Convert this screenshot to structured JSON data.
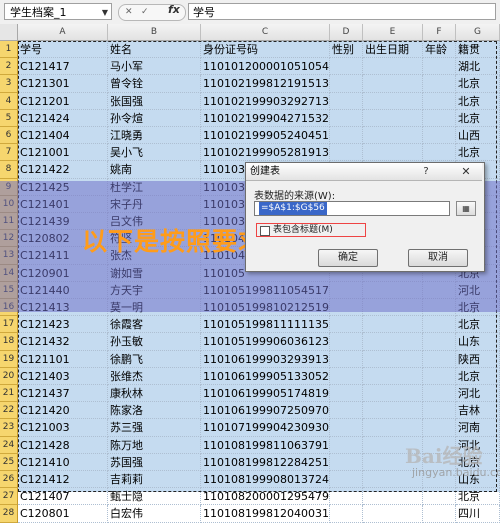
{
  "formula_bar": {
    "name_box": "学生档案_1",
    "fx": "fx",
    "content": "学号"
  },
  "columns": [
    "A",
    "B",
    "C",
    "D",
    "E",
    "F",
    "G"
  ],
  "header": [
    "学号",
    "姓名",
    "身份证号码",
    "性别",
    "出生日期",
    "年龄",
    "籍贯"
  ],
  "rows": [
    [
      "C121417",
      "马小军",
      "110101200001051054",
      "",
      "",
      "",
      "湖北"
    ],
    [
      "C121301",
      "曾令铨",
      "110102199812191513",
      "",
      "",
      "",
      "北京"
    ],
    [
      "C121201",
      "张国强",
      "110102199903292713",
      "",
      "",
      "",
      "北京"
    ],
    [
      "C121424",
      "孙令煊",
      "110102199904271532",
      "",
      "",
      "",
      "北京"
    ],
    [
      "C121404",
      "江晓勇",
      "110102199905240451",
      "",
      "",
      "",
      "山西"
    ],
    [
      "C121001",
      "吴小飞",
      "110102199905281913",
      "",
      "",
      "",
      "北京"
    ],
    [
      "C121422",
      "姚南",
      "110103",
      "",
      "",
      "",
      "北京"
    ],
    [
      "C121425",
      "杜学江",
      "110103",
      "",
      "",
      "",
      "北京"
    ],
    [
      "C121401",
      "宋子丹",
      "110103",
      "",
      "",
      "",
      "北京"
    ],
    [
      "C121439",
      "吕文伟",
      "110103",
      "",
      "",
      "",
      "湖南"
    ],
    [
      "C120802",
      "符坚",
      "110104",
      "",
      "",
      "",
      "山西"
    ],
    [
      "C121411",
      "张杰",
      "110104",
      "",
      "",
      "",
      "北京"
    ],
    [
      "C120901",
      "谢如雪",
      "110105",
      "",
      "",
      "",
      "北京"
    ],
    [
      "C121440",
      "方天宇",
      "110105199811054517",
      "",
      "",
      "",
      "河北"
    ],
    [
      "C121413",
      "莫一明",
      "110105199810212519",
      "",
      "",
      "",
      "北京"
    ],
    [
      "C121423",
      "徐霞客",
      "110105199811111135",
      "",
      "",
      "",
      "北京"
    ],
    [
      "C121432",
      "孙玉敏",
      "110105199906036123",
      "",
      "",
      "",
      "山东"
    ],
    [
      "C121101",
      "徐鹏飞",
      "110106199903293913",
      "",
      "",
      "",
      "陕西"
    ],
    [
      "C121403",
      "张维杰",
      "110106199905133052",
      "",
      "",
      "",
      "北京"
    ],
    [
      "C121437",
      "康秋林",
      "110106199905174819",
      "",
      "",
      "",
      "河北"
    ],
    [
      "C121420",
      "陈家洛",
      "110106199907250970",
      "",
      "",
      "",
      "吉林"
    ],
    [
      "C121003",
      "苏三强",
      "110107199904230930",
      "",
      "",
      "",
      "河南"
    ],
    [
      "C121428",
      "陈万地",
      "110108199811063791",
      "",
      "",
      "",
      "河北"
    ],
    [
      "C121410",
      "苏国强",
      "110108199812284251",
      "",
      "",
      "",
      "北京"
    ],
    [
      "C121412",
      "吉莉莉",
      "110108199908013724",
      "",
      "",
      "",
      "山东"
    ],
    [
      "C121407",
      "甄士隐",
      "110108200001295479",
      "",
      "",
      "",
      "北京"
    ],
    [
      "C120801",
      "白宏伟",
      "110108199812040031",
      "",
      "",
      "",
      "四川"
    ]
  ],
  "dialog": {
    "title": "创建表",
    "help": "?",
    "close": "✕",
    "label": "表数据的来源(W):",
    "range": "=$A$1:$G$56",
    "checkbox_label": "表包含标题(M)",
    "ok": "确定",
    "cancel": "取消"
  },
  "overlay_caption": "以下是按照要求生成的标题",
  "watermark": {
    "main": "Bai经验",
    "sub": "jingyan.baidu.com"
  }
}
